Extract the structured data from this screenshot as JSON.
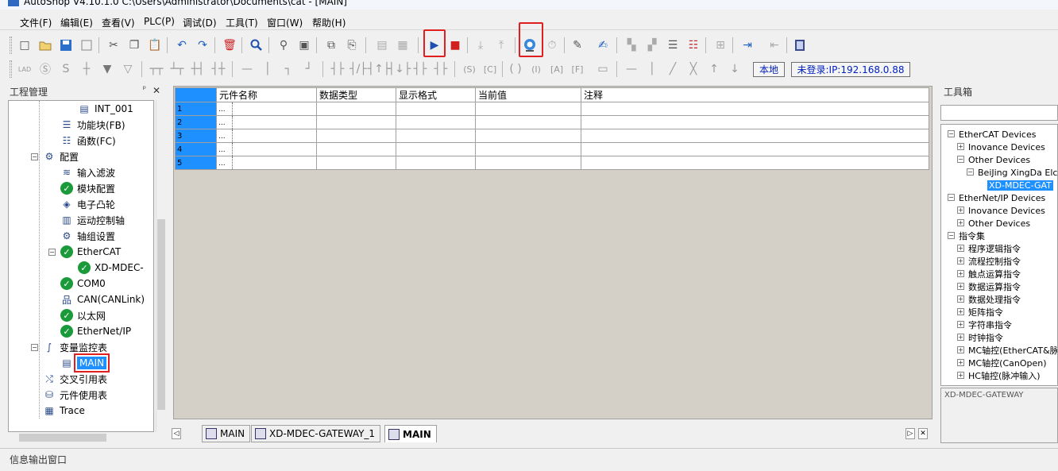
{
  "window": {
    "title": "AutoShop V4.10.1.0  C:\\Users\\Administrator\\Documents\\cat - [MAIN]"
  },
  "menu": [
    "文件(F)",
    "编辑(E)",
    "查看(V)",
    "PLC(P)",
    "调试(D)",
    "工具(T)",
    "窗口(W)",
    "帮助(H)"
  ],
  "toolbar": {
    "conn_mode": "本地",
    "login_prefix": "未登录:",
    "login_ip": "IP:192.168.0.88"
  },
  "project_panel": {
    "title": "工程管理",
    "pin": "ᵖ",
    "close": "✕",
    "items": [
      {
        "label": "INT_001",
        "icon": "document-icon",
        "indent": 3
      },
      {
        "label": "功能块(FB)",
        "icon": "function-block-icon",
        "indent": 2
      },
      {
        "label": "函数(FC)",
        "icon": "function-icon",
        "indent": 2
      },
      {
        "label": "配置",
        "icon": "config-icon",
        "indent": 1,
        "expand": "−"
      },
      {
        "label": "输入滤波",
        "icon": "filter-icon",
        "indent": 2
      },
      {
        "label": "模块配置",
        "icon": "check-icon",
        "indent": 2
      },
      {
        "label": "电子凸轮",
        "icon": "cam-icon",
        "indent": 2
      },
      {
        "label": "运动控制轴",
        "icon": "axis-icon",
        "indent": 2
      },
      {
        "label": "轴组设置",
        "icon": "gear-icon",
        "indent": 2
      },
      {
        "label": "EtherCAT",
        "icon": "check-icon",
        "indent": 2,
        "expand": "−"
      },
      {
        "label": "XD-MDEC-",
        "icon": "check-icon",
        "indent": 3
      },
      {
        "label": "COM0",
        "icon": "check-icon",
        "indent": 2
      },
      {
        "label": "CAN(CANLink)",
        "icon": "network-icon",
        "indent": 2
      },
      {
        "label": "以太网",
        "icon": "check-icon",
        "indent": 2
      },
      {
        "label": "EtherNet/IP",
        "icon": "check-icon",
        "indent": 2
      },
      {
        "label": "变量监控表",
        "icon": "monitor-icon",
        "indent": 1,
        "expand": "−"
      },
      {
        "label": "MAIN",
        "icon": "table-icon",
        "indent": 2,
        "selected": true
      },
      {
        "label": "交叉引用表",
        "icon": "cross-ref-icon",
        "indent": 1
      },
      {
        "label": "元件使用表",
        "icon": "database-icon",
        "indent": 1
      },
      {
        "label": "Trace",
        "icon": "trace-icon",
        "indent": 1
      }
    ]
  },
  "monitor_table": {
    "columns": [
      "元件名称",
      "数据类型",
      "显示格式",
      "当前值",
      "注释"
    ],
    "rows": [
      "1",
      "2",
      "3",
      "4",
      "5"
    ],
    "cell_placeholder": "..."
  },
  "tabs": [
    {
      "label": "MAIN",
      "active": false
    },
    {
      "label": "XD-MDEC-GATEWAY_1",
      "active": false
    },
    {
      "label": "MAIN",
      "active": true
    }
  ],
  "toolbox": {
    "title": "工具箱",
    "items": [
      {
        "label": "EtherCAT Devices",
        "indent": 0,
        "expand": "−"
      },
      {
        "label": "Inovance Devices",
        "indent": 1,
        "expand": "+"
      },
      {
        "label": "Other Devices",
        "indent": 1,
        "expand": "−"
      },
      {
        "label": "BeiJing XingDa Elc",
        "indent": 2,
        "expand": "−"
      },
      {
        "label": "XD-MDEC-GAT",
        "indent": 3,
        "selected": true
      },
      {
        "label": "EtherNet/IP Devices",
        "indent": 0,
        "expand": "−"
      },
      {
        "label": "Inovance Devices",
        "indent": 1,
        "expand": "+"
      },
      {
        "label": "Other Devices",
        "indent": 1,
        "expand": "+"
      },
      {
        "label": "指令集",
        "indent": 0,
        "expand": "−"
      },
      {
        "label": "程序逻辑指令",
        "indent": 1,
        "expand": "+"
      },
      {
        "label": "流程控制指令",
        "indent": 1,
        "expand": "+"
      },
      {
        "label": "触点运算指令",
        "indent": 1,
        "expand": "+"
      },
      {
        "label": "数据运算指令",
        "indent": 1,
        "expand": "+"
      },
      {
        "label": "数据处理指令",
        "indent": 1,
        "expand": "+"
      },
      {
        "label": "矩阵指令",
        "indent": 1,
        "expand": "+"
      },
      {
        "label": "字符串指令",
        "indent": 1,
        "expand": "+"
      },
      {
        "label": "时钟指令",
        "indent": 1,
        "expand": "+"
      },
      {
        "label": "MC轴控(EtherCAT&脉",
        "indent": 1,
        "expand": "+"
      },
      {
        "label": "MC轴控(CanOpen)",
        "indent": 1,
        "expand": "+"
      },
      {
        "label": "HC轴控(脉冲输入)",
        "indent": 1,
        "expand": "+"
      }
    ],
    "description": "XD-MDEC-GATEWAY"
  },
  "status_bar": {
    "label": "信息输出窗口"
  },
  "colors": {
    "accent": "#1e90ff",
    "highlight": "#e02020",
    "ok": "#1a9a3a"
  }
}
